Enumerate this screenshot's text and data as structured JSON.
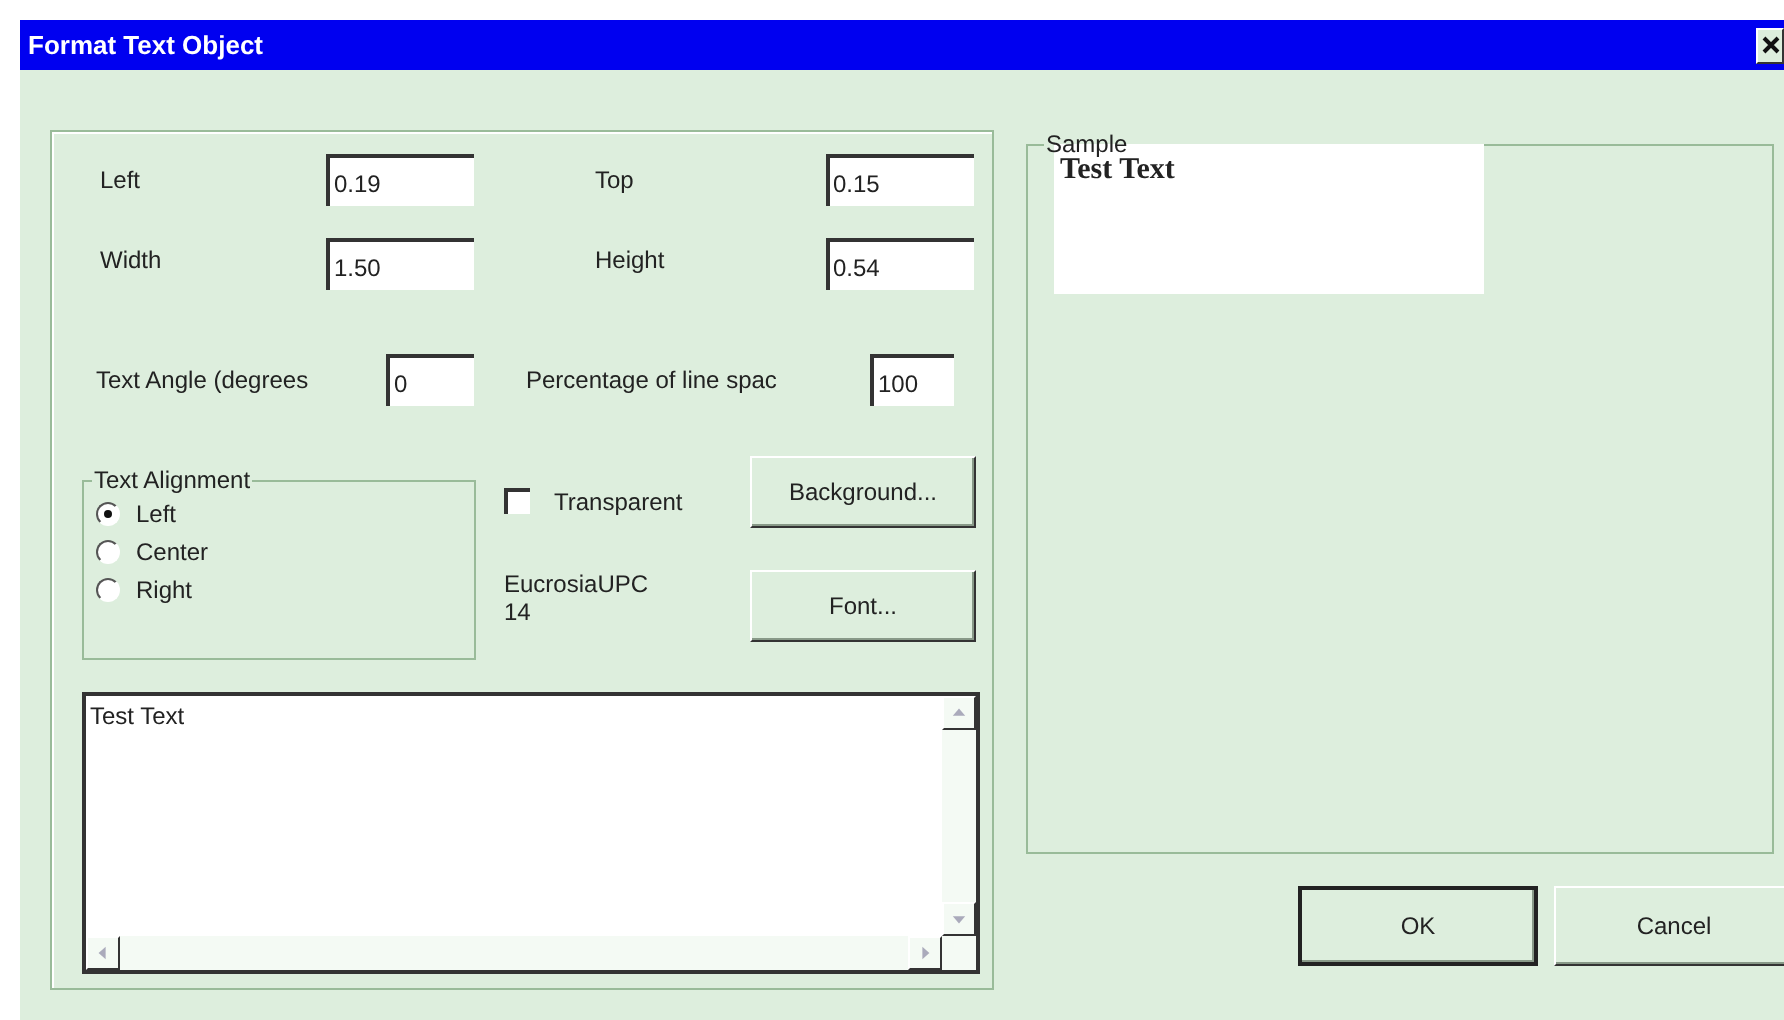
{
  "window": {
    "title": "Format Text Object"
  },
  "position_fields": [
    {
      "label": "Left",
      "value": "0.19"
    },
    {
      "label": "Top",
      "value": "0.15"
    },
    {
      "label": "Width",
      "value": "1.50"
    },
    {
      "label": "Height",
      "value": "0.54"
    },
    {
      "label": "Text Angle (degrees",
      "value": "0"
    },
    {
      "label": "Percentage of line spac",
      "value": "100"
    }
  ],
  "text_alignment": {
    "title": "Text Alignment",
    "options": [
      {
        "label": "Left",
        "selected": true
      },
      {
        "label": "Center",
        "selected": false
      },
      {
        "label": "Right",
        "selected": false
      }
    ]
  },
  "transparent": {
    "label": "Transparent",
    "checked": false
  },
  "background_button": "Background...",
  "font": {
    "name": "EucrosiaUPC",
    "size": "14"
  },
  "font_button": "Font...",
  "text": "Test Text",
  "sample": {
    "title": "Sample",
    "text": "Test Text"
  },
  "buttons": [
    {
      "label": "OK",
      "default": true
    },
    {
      "label": "Cancel",
      "default": false
    }
  ]
}
